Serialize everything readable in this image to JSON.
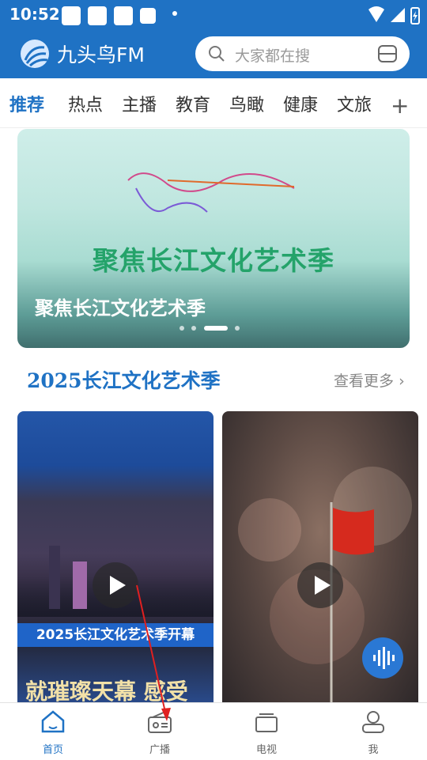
{
  "status_bar": {
    "time": "10:52"
  },
  "app": {
    "name": "九头鸟FM"
  },
  "search": {
    "placeholder": "大家都在搜"
  },
  "tabs": [
    {
      "label": "推荐",
      "active": true
    },
    {
      "label": "热点"
    },
    {
      "label": "主播"
    },
    {
      "label": "教育"
    },
    {
      "label": "鸟瞰"
    },
    {
      "label": "健康"
    },
    {
      "label": "文旅"
    }
  ],
  "banner": {
    "headline": "聚焦长江文化艺术季",
    "title": "聚焦长江文化艺术季",
    "pager": {
      "count": 4,
      "active_index": 2
    }
  },
  "section": {
    "title": "2025长江文化艺术季",
    "more": "查看更多"
  },
  "cards": [
    {
      "caption": "2025长江文化艺术季开幕",
      "subline": "就璀璨天幕 感受"
    },
    {}
  ],
  "bottom_nav": [
    {
      "label": "首页",
      "icon": "home-icon",
      "active": true
    },
    {
      "label": "广播",
      "icon": "radio-icon"
    },
    {
      "label": "电视",
      "icon": "tv-icon"
    },
    {
      "label": "我",
      "icon": "profile-icon"
    }
  ],
  "colors": {
    "brand": "#1f72c4",
    "banner_green": "#24a36a",
    "annotation": "#e02020"
  }
}
